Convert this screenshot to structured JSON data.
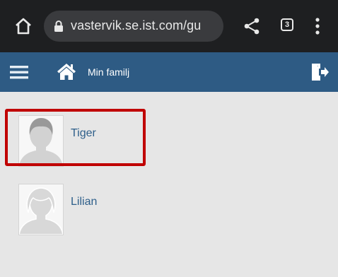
{
  "browser": {
    "url": "vastervik.se.ist.com/gu",
    "tab_count": "3",
    "icons": [
      "home-icon",
      "lock-icon",
      "share-icon",
      "tabs-icon",
      "more-vert-icon"
    ],
    "bar_color": "#1e1f21"
  },
  "header": {
    "title": "Min familj",
    "icons": [
      "hamburger-icon",
      "house-icon",
      "logout-icon"
    ],
    "color": "#2e5b84"
  },
  "members": [
    {
      "name": "Tiger",
      "avatar": "child-avatar-icon",
      "highlighted": true
    },
    {
      "name": "Lilian",
      "avatar": "adult-avatar-icon",
      "highlighted": false
    }
  ],
  "colors": {
    "background": "#e6e6e6",
    "name_link": "#2e5f8a",
    "highlight": "#c00000"
  }
}
